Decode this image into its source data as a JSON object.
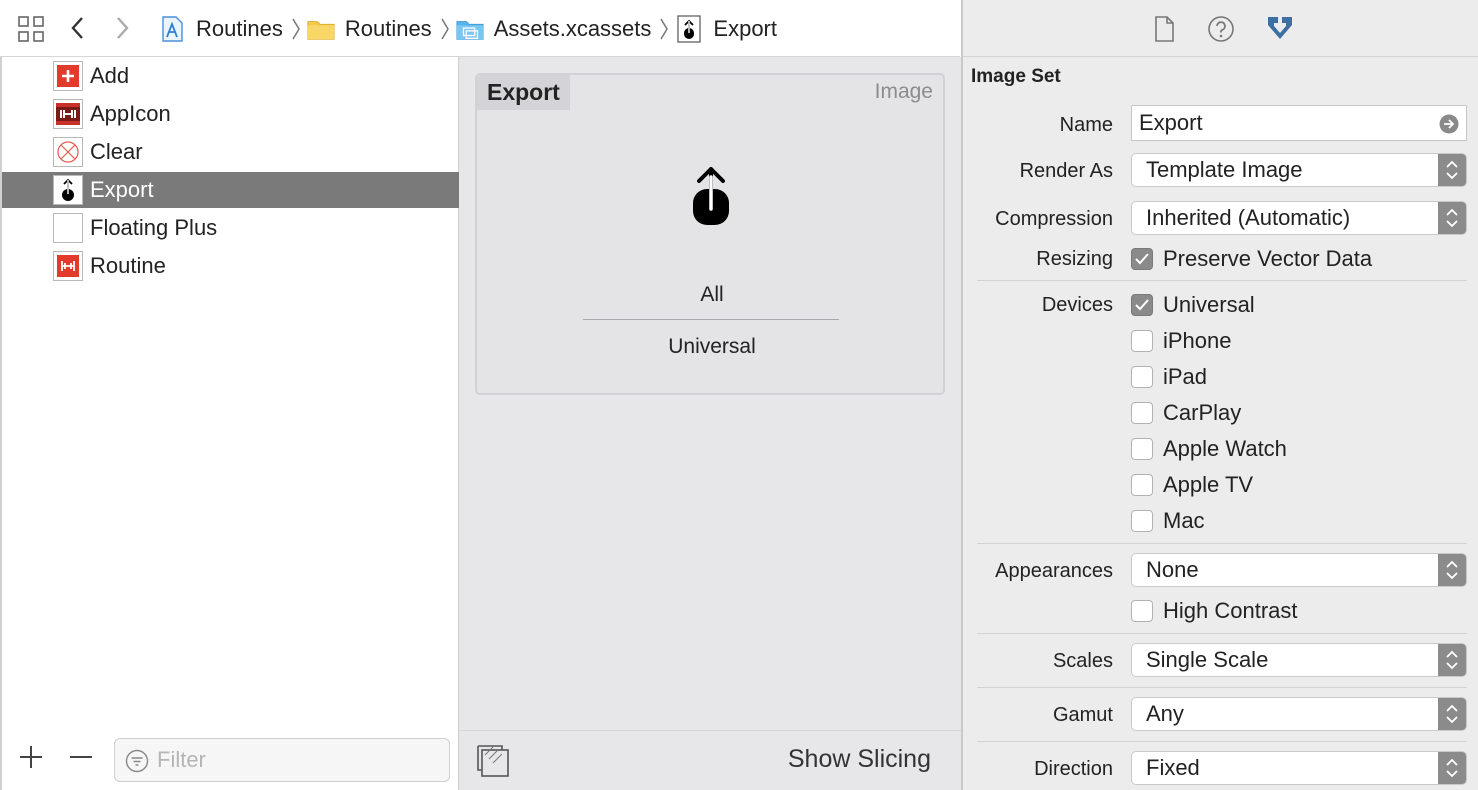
{
  "breadcrumbs": [
    {
      "label": "Routines",
      "icon": "xcode-project-icon"
    },
    {
      "label": "Routines",
      "icon": "folder-icon"
    },
    {
      "label": "Assets.xcassets",
      "icon": "asset-catalog-icon"
    },
    {
      "label": "Export",
      "icon": "image-asset-icon"
    }
  ],
  "navigator": {
    "items": [
      {
        "label": "Add",
        "icon": "add-asset-icon"
      },
      {
        "label": "AppIcon",
        "icon": "appicon-asset-icon"
      },
      {
        "label": "Clear",
        "icon": "clear-asset-icon"
      },
      {
        "label": "Export",
        "icon": "export-asset-icon",
        "selected": true
      },
      {
        "label": "Floating Plus",
        "icon": "floating-plus-asset-icon"
      },
      {
        "label": "Routine",
        "icon": "routine-asset-icon"
      }
    ],
    "filter_placeholder": "Filter"
  },
  "editor": {
    "asset_name": "Export",
    "asset_type": "Image",
    "slot_scale": "All",
    "slot_device": "Universal",
    "show_slicing_label": "Show Slicing"
  },
  "inspector": {
    "section_title": "Image Set",
    "name_label": "Name",
    "name_value": "Export",
    "render_as_label": "Render As",
    "render_as_value": "Template Image",
    "compression_label": "Compression",
    "compression_value": "Inherited (Automatic)",
    "resizing_label": "Resizing",
    "preserve_vector_label": "Preserve Vector Data",
    "preserve_vector_checked": true,
    "devices_label": "Devices",
    "devices": [
      {
        "label": "Universal",
        "checked": true
      },
      {
        "label": "iPhone",
        "checked": false
      },
      {
        "label": "iPad",
        "checked": false
      },
      {
        "label": "CarPlay",
        "checked": false
      },
      {
        "label": "Apple Watch",
        "checked": false
      },
      {
        "label": "Apple TV",
        "checked": false
      },
      {
        "label": "Mac",
        "checked": false
      }
    ],
    "appearances_label": "Appearances",
    "appearances_value": "None",
    "high_contrast_label": "High Contrast",
    "high_contrast_checked": false,
    "scales_label": "Scales",
    "scales_value": "Single Scale",
    "gamut_label": "Gamut",
    "gamut_value": "Any",
    "direction_label": "Direction",
    "direction_value": "Fixed"
  },
  "colors": {
    "selection": "#7a7a7a",
    "asset_red": "#e23a2b",
    "folder_yellow": "#f5c84a",
    "catalog_blue": "#57b5ec",
    "attributes_tab_active": "#3e6fa3"
  }
}
